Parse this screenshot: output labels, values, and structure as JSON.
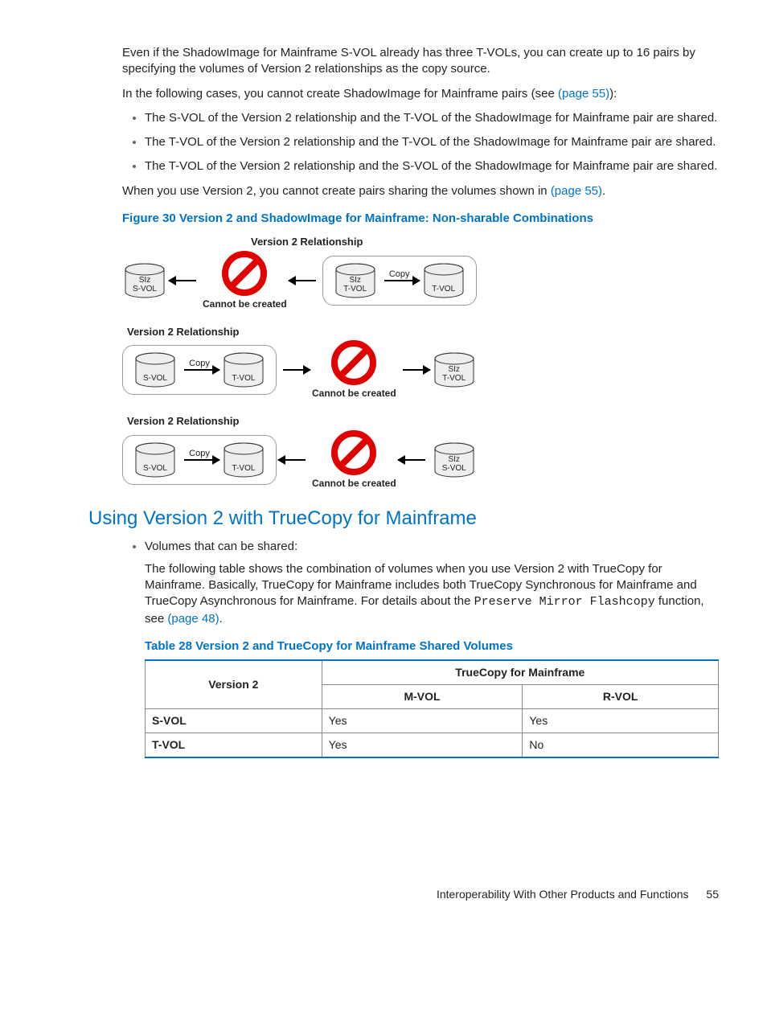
{
  "intro": {
    "p1": "Even if the ShadowImage for Mainframe S-VOL already has three T-VOLs, you can create up to 16 pairs by specifying the volumes of Version 2 relationships as the copy source.",
    "p2_a": "In the following cases, you cannot create ShadowImage for Mainframe pairs (see ",
    "p2_link": "(page 55)",
    "p2_b": "):",
    "bullets": [
      "The S-VOL of the Version 2 relationship and the T-VOL of the ShadowImage for Mainframe pair are shared.",
      "The T-VOL of the Version 2 relationship and the T-VOL of the ShadowImage for Mainframe pair are shared.",
      "The T-VOL of the Version 2 relationship and the S-VOL of the ShadowImage for Mainframe pair are shared."
    ],
    "p3_a": "When you use Version 2, you cannot create pairs sharing the volumes shown in ",
    "p3_link": "(page 55)",
    "p3_b": "."
  },
  "figure": {
    "caption": "Figure 30 Version 2 and ShadowImage for Mainframe: Non-sharable Combinations",
    "rel_label": "Version 2 Relationship",
    "cannot": "Cannot be created",
    "copy": "Copy",
    "labels": {
      "siz_svol": "SIz\nS-VOL",
      "siz_tvol": "SIz\nT-VOL",
      "tvol": "T-VOL",
      "svol": "S-VOL"
    }
  },
  "section2": {
    "heading": "Using Version 2 with TrueCopy for Mainframe",
    "bullet": "Volumes that can be shared:",
    "p1_a": "The following table shows the combination of volumes when you use Version 2 with TrueCopy for Mainframe. Basically, TrueCopy for Mainframe includes both TrueCopy Synchronous for Mainframe and TrueCopy Asynchronous for Mainframe. For details about the ",
    "p1_mono": "Preserve Mirror Flashcopy",
    "p1_b": " function, see ",
    "p1_link": "(page 48)",
    "p1_c": "."
  },
  "table": {
    "caption": "Table 28 Version 2 and TrueCopy for Mainframe Shared Volumes",
    "head_v2": "Version 2",
    "head_tc": "TrueCopy for Mainframe",
    "head_mvol": "M-VOL",
    "head_rvol": "R-VOL",
    "rows": [
      {
        "label": "S-VOL",
        "mvol": "Yes",
        "rvol": "Yes"
      },
      {
        "label": "T-VOL",
        "mvol": "Yes",
        "rvol": "No"
      }
    ]
  },
  "footer": {
    "text": "Interoperability With Other Products and Functions",
    "page": "55"
  }
}
